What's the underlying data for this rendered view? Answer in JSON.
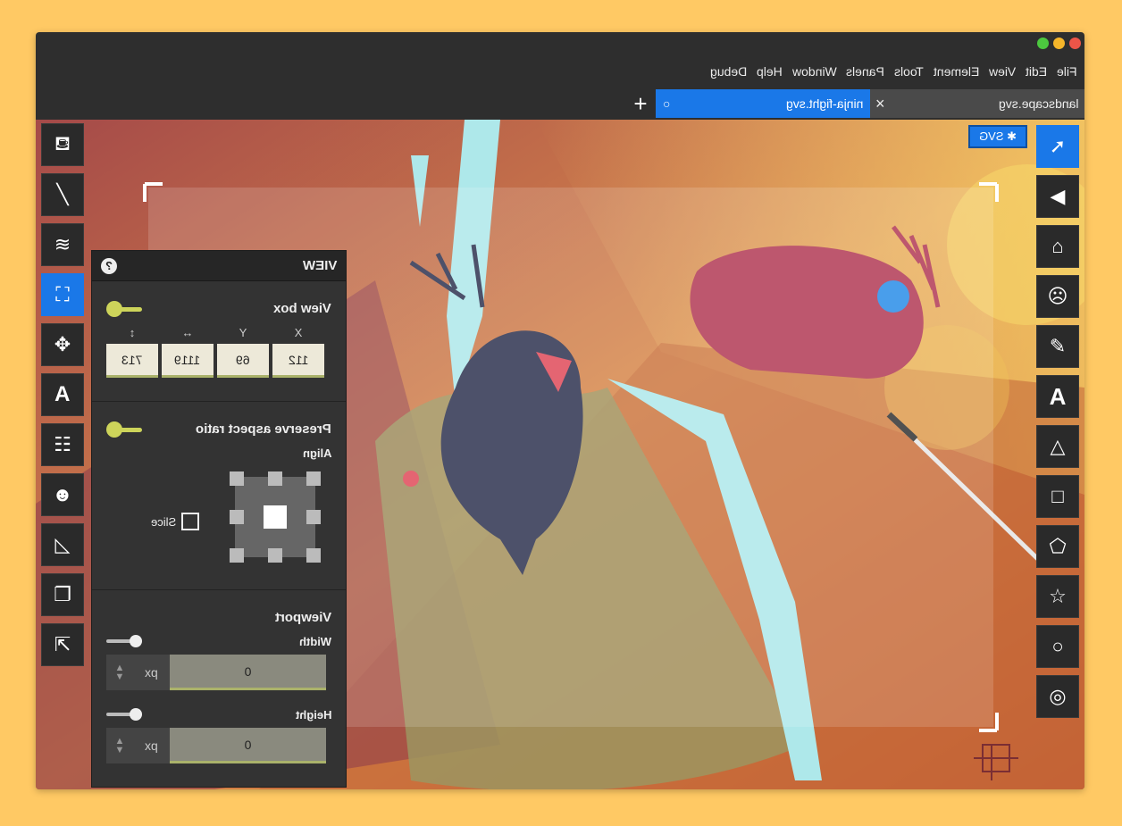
{
  "menu": [
    "File",
    "Edit",
    "View",
    "Element",
    "Tools",
    "Panels",
    "Window",
    "Help",
    "Debug"
  ],
  "tabs": {
    "left_tab": "landscape.svg",
    "active_tab": "ninja-fight.svg",
    "new_tab": "+",
    "close": "×",
    "dirty": "○"
  },
  "badge": {
    "label": "✱ SVG"
  },
  "panel": {
    "title": "VIEW",
    "help": "?",
    "viewbox": {
      "title": "View box",
      "headers": [
        "X",
        "Y",
        "↔",
        "↕"
      ],
      "values": [
        "112",
        "69",
        "1119",
        "713"
      ]
    },
    "aspect": {
      "title": "Preserve aspect ratio",
      "align_label": "Align",
      "slice_label": "Slice"
    },
    "viewport": {
      "title": "Viewport",
      "width_label": "Width",
      "width_value": "0",
      "width_unit": "px",
      "height_label": "Height",
      "height_value": "0",
      "height_unit": "px"
    }
  },
  "left_tools": [
    "paint-bucket-icon",
    "brush-icon",
    "layers-icon",
    "view-frame-icon",
    "move-icon",
    "typography-icon",
    "list-grid-icon",
    "mask-icon",
    "ruler-triangle-icon",
    "arrange-icon",
    "export-icon"
  ],
  "right_tools": [
    "select-arrow-icon",
    "direct-select-icon",
    "node-icon",
    "face-icon",
    "pencil-icon",
    "text-icon",
    "triangle-icon",
    "rectangle-icon",
    "pentagon-icon",
    "star-icon",
    "circle-icon",
    "ring-icon"
  ],
  "right_text_tool": "A",
  "left_text_tool": "A"
}
